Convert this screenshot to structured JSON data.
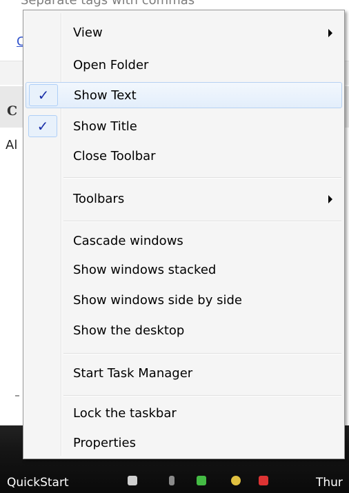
{
  "background": {
    "top_text": "Separate tags with commas",
    "link_text": "C",
    "header_text": "C",
    "body_text": "Al"
  },
  "menu": {
    "items": [
      {
        "label": "View",
        "submenu": true,
        "checked": false
      },
      {
        "label": "Open Folder",
        "submenu": false,
        "checked": false
      },
      {
        "label": "Show Text",
        "submenu": false,
        "checked": true,
        "hover": true
      },
      {
        "label": "Show Title",
        "submenu": false,
        "checked": true
      },
      {
        "label": "Close Toolbar",
        "submenu": false,
        "checked": false
      },
      {
        "label": "Toolbars",
        "submenu": true,
        "checked": false
      },
      {
        "label": "Cascade windows",
        "submenu": false,
        "checked": false
      },
      {
        "label": "Show windows stacked",
        "submenu": false,
        "checked": false
      },
      {
        "label": "Show windows side by side",
        "submenu": false,
        "checked": false
      },
      {
        "label": "Show the desktop",
        "submenu": false,
        "checked": false
      },
      {
        "label": "Start Task Manager",
        "submenu": false,
        "checked": false
      },
      {
        "label": "Lock the taskbar",
        "submenu": false,
        "checked": false
      },
      {
        "label": "Properties",
        "submenu": false,
        "checked": false
      }
    ],
    "check_glyph": "✓",
    "colors": {
      "background": "#f5f5f5",
      "border": "#979797",
      "hover_border": "#b6d1f2",
      "check": "#1a2fa8"
    }
  },
  "taskbar": {
    "label": "QuickStart",
    "clock": "Thur"
  }
}
